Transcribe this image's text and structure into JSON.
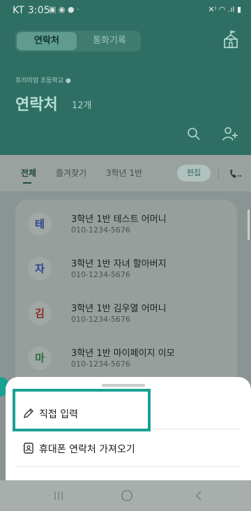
{
  "status": {
    "time": "KT 3:05",
    "left_icons": "▣ ◉ ● ·",
    "right_icons": "✕⁾ ◠ .ıl ▮"
  },
  "header": {
    "tab_contacts": "연락처",
    "tab_calllog": "통화기록",
    "premium_label": "프리미엄 초등학교",
    "title": "연락처",
    "count": "12개"
  },
  "tabs": {
    "all": "전체",
    "favorites": "즐겨찾기",
    "class": "3학년 1반",
    "edit": "편집"
  },
  "contacts": [
    {
      "initial": "테",
      "initial_color": "#2b3f8e",
      "name": "3학년 1반 테스트 어머니",
      "phone": "010-1234-5676"
    },
    {
      "initial": "자",
      "initial_color": "#2b3f8e",
      "name": "3학년 1반 자녀 할아버지",
      "phone": "010-1234-5676"
    },
    {
      "initial": "김",
      "initial_color": "#8e2b2b",
      "name": "3학년 1반 김우열 어머니",
      "phone": "010-1234-5676"
    },
    {
      "initial": "마",
      "initial_color": "#2b6e3f",
      "name": "3학년 1반 마이페이지 이모",
      "phone": "010-1234-5676"
    }
  ],
  "sheet": {
    "direct_input": "직접 입력",
    "import_contacts": "휴대폰 연락처 가져오기"
  },
  "colors": {
    "primary": "#2f6f63",
    "highlight": "#1aa193"
  }
}
